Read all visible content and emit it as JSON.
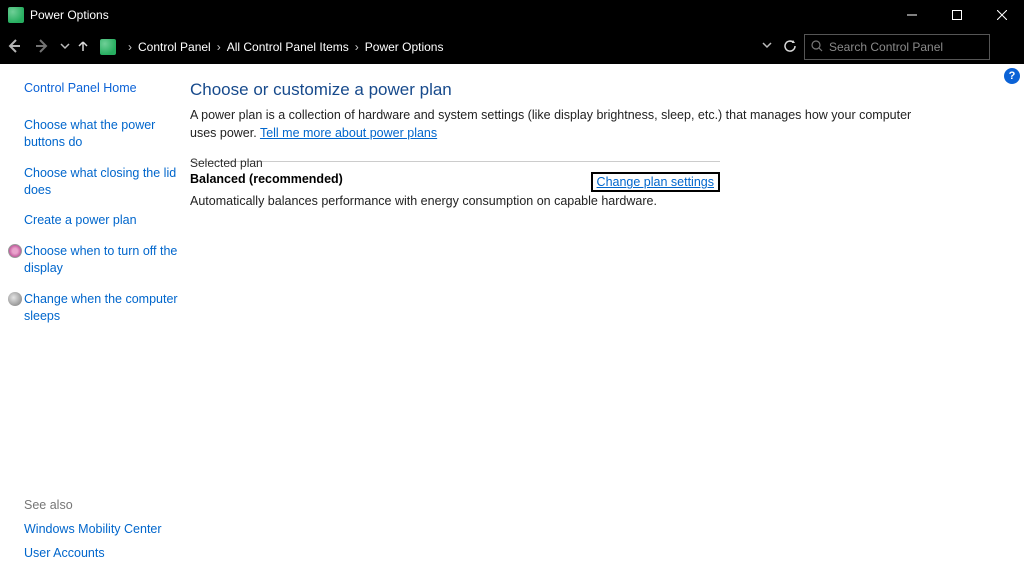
{
  "window": {
    "title": "Power Options"
  },
  "breadcrumbs": {
    "a": "Control Panel",
    "b": "All Control Panel Items",
    "c": "Power Options"
  },
  "search": {
    "placeholder": "Search Control Panel"
  },
  "sidebar": {
    "home": "Control Panel Home",
    "items": {
      "0": "Choose what the power buttons do",
      "1": "Choose what closing the lid does",
      "2": "Create a power plan",
      "3": "Choose when to turn off the display",
      "4": "Change when the computer sleeps"
    }
  },
  "seeAlso": {
    "header": "See also",
    "a": "Windows Mobility Center",
    "b": "User Accounts"
  },
  "main": {
    "heading": "Choose or customize a power plan",
    "desc_pre": "A power plan is a collection of hardware and system settings (like display brightness, sleep, etc.) that manages how your computer uses power. ",
    "desc_link": "Tell me more about power plans",
    "legend": "Selected plan",
    "plan_name": "Balanced (recommended)",
    "plan_desc": "Automatically balances performance with energy consumption on capable hardware.",
    "change_link": "Change plan settings"
  }
}
